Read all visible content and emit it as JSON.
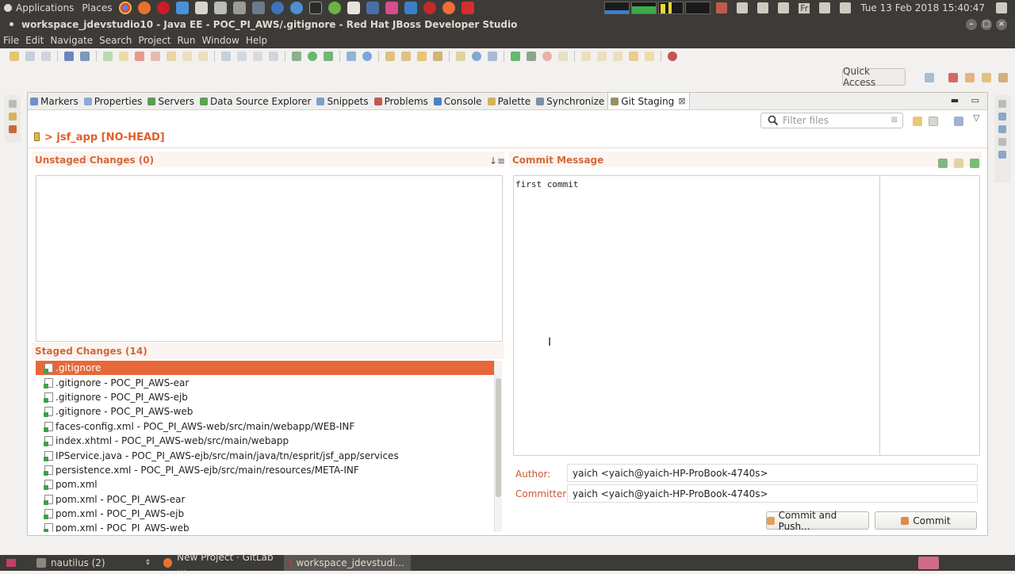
{
  "top_panel": {
    "applications": "Applications",
    "places": "Places",
    "datetime": "Tue 13 Feb 2018 15:40:47",
    "keyboard": "Fr"
  },
  "window": {
    "title": "workspace_jdevstudio10 - Java EE - POC_PI_AWS/.gitignore - Red Hat JBoss Developer Studio"
  },
  "menu": [
    "File",
    "Edit",
    "Navigate",
    "Search",
    "Project",
    "Run",
    "Window",
    "Help"
  ],
  "quick_access": "Quick Access",
  "tabs": [
    {
      "label": "Markers",
      "color": "#6f8fc9"
    },
    {
      "label": "Properties",
      "color": "#8da9d4"
    },
    {
      "label": "Servers",
      "color": "#5b9b54"
    },
    {
      "label": "Data Source Explorer",
      "color": "#5ca24f"
    },
    {
      "label": "Snippets",
      "color": "#7ea1c9"
    },
    {
      "label": "Problems",
      "color": "#c05a4d"
    },
    {
      "label": "Console",
      "color": "#4f7fc0"
    },
    {
      "label": "Palette",
      "color": "#d4b25b"
    },
    {
      "label": "Synchronize",
      "color": "#7d8fa3"
    },
    {
      "label": "Git Staging",
      "color": "#9a8f62",
      "active": true,
      "close": "⊠"
    }
  ],
  "filter": {
    "placeholder": "Filter files"
  },
  "repo_title": "> jsf_app [NO-HEAD]",
  "unstaged": {
    "title": "Unstaged Changes (0)",
    "items": []
  },
  "staged": {
    "title": "Staged Changes (14)",
    "items": [
      ".gitignore",
      ".gitignore - POC_PI_AWS-ear",
      ".gitignore - POC_PI_AWS-ejb",
      ".gitignore - POC_PI_AWS-web",
      "faces-config.xml - POC_PI_AWS-web/src/main/webapp/WEB-INF",
      "index.xhtml - POC_PI_AWS-web/src/main/webapp",
      "IPService.java - POC_PI_AWS-ejb/src/main/java/tn/esprit/jsf_app/services",
      "persistence.xml - POC_PI_AWS-ejb/src/main/resources/META-INF",
      "pom.xml",
      "pom.xml - POC_PI_AWS-ear",
      "pom.xml - POC_PI_AWS-ejb",
      "pom.xml - POC_PI_AWS-web"
    ],
    "selected_index": 0
  },
  "commit": {
    "title": "Commit Message",
    "message": "first commit",
    "author_label": "Author:",
    "author": "yaich <yaich@yaich-HP-ProBook-4740s>",
    "committer_label": "Committer:",
    "committer": "yaich <yaich@yaich-HP-ProBook-4740s>",
    "commit_and_push": "Commit and Push...",
    "commit_button": "Commit"
  },
  "taskbar": [
    {
      "label": "nautilus (2)",
      "icon": "folder-icon",
      "color": "#8a8780"
    },
    {
      "label": "New Project · GitLab ...",
      "icon": "firefox-icon",
      "color": "#e8722a"
    },
    {
      "label": "workspace_jdevstudi...",
      "icon": "jboss-icon",
      "color": "#c93a3a",
      "active": true
    }
  ]
}
